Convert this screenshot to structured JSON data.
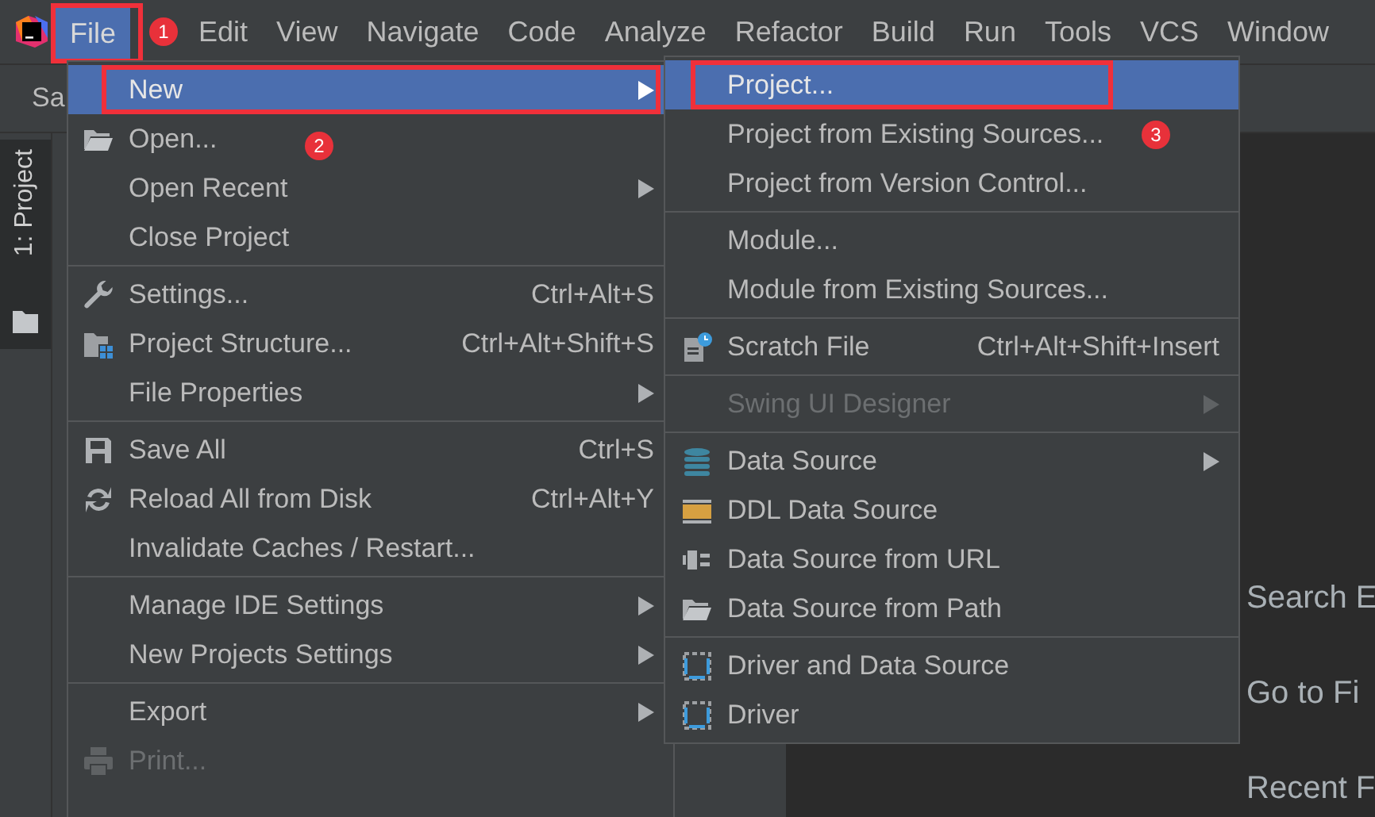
{
  "menubar": {
    "items": [
      {
        "label": "File",
        "selected": true,
        "boxed": true,
        "badge": "1"
      },
      {
        "label": "Edit",
        "selected": false,
        "boxed": false
      },
      {
        "label": "View",
        "selected": false,
        "boxed": false
      },
      {
        "label": "Navigate",
        "selected": false,
        "boxed": false
      },
      {
        "label": "Code",
        "selected": false,
        "boxed": false
      },
      {
        "label": "Analyze",
        "selected": false,
        "boxed": false
      },
      {
        "label": "Refactor",
        "selected": false,
        "boxed": false
      },
      {
        "label": "Build",
        "selected": false,
        "boxed": false
      },
      {
        "label": "Run",
        "selected": false,
        "boxed": false
      },
      {
        "label": "Tools",
        "selected": false,
        "boxed": false
      },
      {
        "label": "VCS",
        "selected": false,
        "boxed": false
      },
      {
        "label": "Window",
        "selected": false,
        "boxed": false
      }
    ]
  },
  "toolbar": {
    "text": "Sa"
  },
  "tool_window_tab": {
    "label": "1: Project"
  },
  "editor": {
    "hints": [
      "Search E",
      "Go to Fi",
      "Recent F"
    ]
  },
  "file_menu": {
    "groups": [
      [
        {
          "label": "New",
          "submenu": true,
          "selected": true,
          "disabled": false,
          "boxed": true,
          "badge": "2"
        },
        {
          "label": "Open...",
          "submenu": false,
          "selected": false,
          "disabled": false,
          "boxed": false
        },
        {
          "label": "Open Recent",
          "submenu": true,
          "selected": false,
          "disabled": false,
          "boxed": false
        },
        {
          "label": "Close Project",
          "submenu": false,
          "selected": false,
          "disabled": false,
          "boxed": false
        }
      ],
      [
        {
          "label": "Settings...",
          "shortcut": "Ctrl+Alt+S",
          "submenu": false,
          "selected": false,
          "disabled": false,
          "boxed": false
        },
        {
          "label": "Project Structure...",
          "shortcut": "Ctrl+Alt+Shift+S",
          "submenu": false,
          "selected": false,
          "disabled": false,
          "boxed": false
        },
        {
          "label": "File Properties",
          "submenu": true,
          "selected": false,
          "disabled": false,
          "boxed": false
        }
      ],
      [
        {
          "label": "Save All",
          "shortcut": "Ctrl+S",
          "submenu": false,
          "selected": false,
          "disabled": false,
          "boxed": false
        },
        {
          "label": "Reload All from Disk",
          "shortcut": "Ctrl+Alt+Y",
          "submenu": false,
          "selected": false,
          "disabled": false,
          "boxed": false
        },
        {
          "label": "Invalidate Caches / Restart...",
          "submenu": false,
          "selected": false,
          "disabled": false,
          "boxed": false
        }
      ],
      [
        {
          "label": "Manage IDE Settings",
          "submenu": true,
          "selected": false,
          "disabled": false,
          "boxed": false
        },
        {
          "label": "New Projects Settings",
          "submenu": true,
          "selected": false,
          "disabled": false,
          "boxed": false
        }
      ],
      [
        {
          "label": "Export",
          "submenu": true,
          "selected": false,
          "disabled": false,
          "boxed": false
        },
        {
          "label": "Print...",
          "submenu": false,
          "selected": false,
          "disabled": true,
          "boxed": false
        }
      ]
    ]
  },
  "new_submenu": {
    "groups": [
      [
        {
          "label": "Project...",
          "submenu": false,
          "selected": true,
          "disabled": false,
          "boxed": true,
          "badge": "3"
        },
        {
          "label": "Project from Existing Sources...",
          "submenu": false,
          "selected": false,
          "disabled": false,
          "boxed": false
        },
        {
          "label": "Project from Version Control...",
          "submenu": false,
          "selected": false,
          "disabled": false,
          "boxed": false
        }
      ],
      [
        {
          "label": "Module...",
          "submenu": false,
          "selected": false,
          "disabled": false,
          "boxed": false
        },
        {
          "label": "Module from Existing Sources...",
          "submenu": false,
          "selected": false,
          "disabled": false,
          "boxed": false
        }
      ],
      [
        {
          "label": "Scratch File",
          "shortcut": "Ctrl+Alt+Shift+Insert",
          "submenu": false,
          "selected": false,
          "disabled": false,
          "boxed": false
        }
      ],
      [
        {
          "label": "Swing UI Designer",
          "submenu": true,
          "selected": false,
          "disabled": true,
          "boxed": false
        }
      ],
      [
        {
          "label": "Data Source",
          "submenu": true,
          "selected": false,
          "disabled": false,
          "boxed": false
        },
        {
          "label": "DDL Data Source",
          "submenu": false,
          "selected": false,
          "disabled": false,
          "boxed": false
        },
        {
          "label": "Data Source from URL",
          "submenu": false,
          "selected": false,
          "disabled": false,
          "boxed": false
        },
        {
          "label": "Data Source from Path",
          "submenu": false,
          "selected": false,
          "disabled": false,
          "boxed": false
        }
      ],
      [
        {
          "label": "Driver and Data Source",
          "submenu": false,
          "selected": false,
          "disabled": false,
          "boxed": false
        },
        {
          "label": "Driver",
          "submenu": false,
          "selected": false,
          "disabled": false,
          "boxed": false
        }
      ]
    ]
  }
}
